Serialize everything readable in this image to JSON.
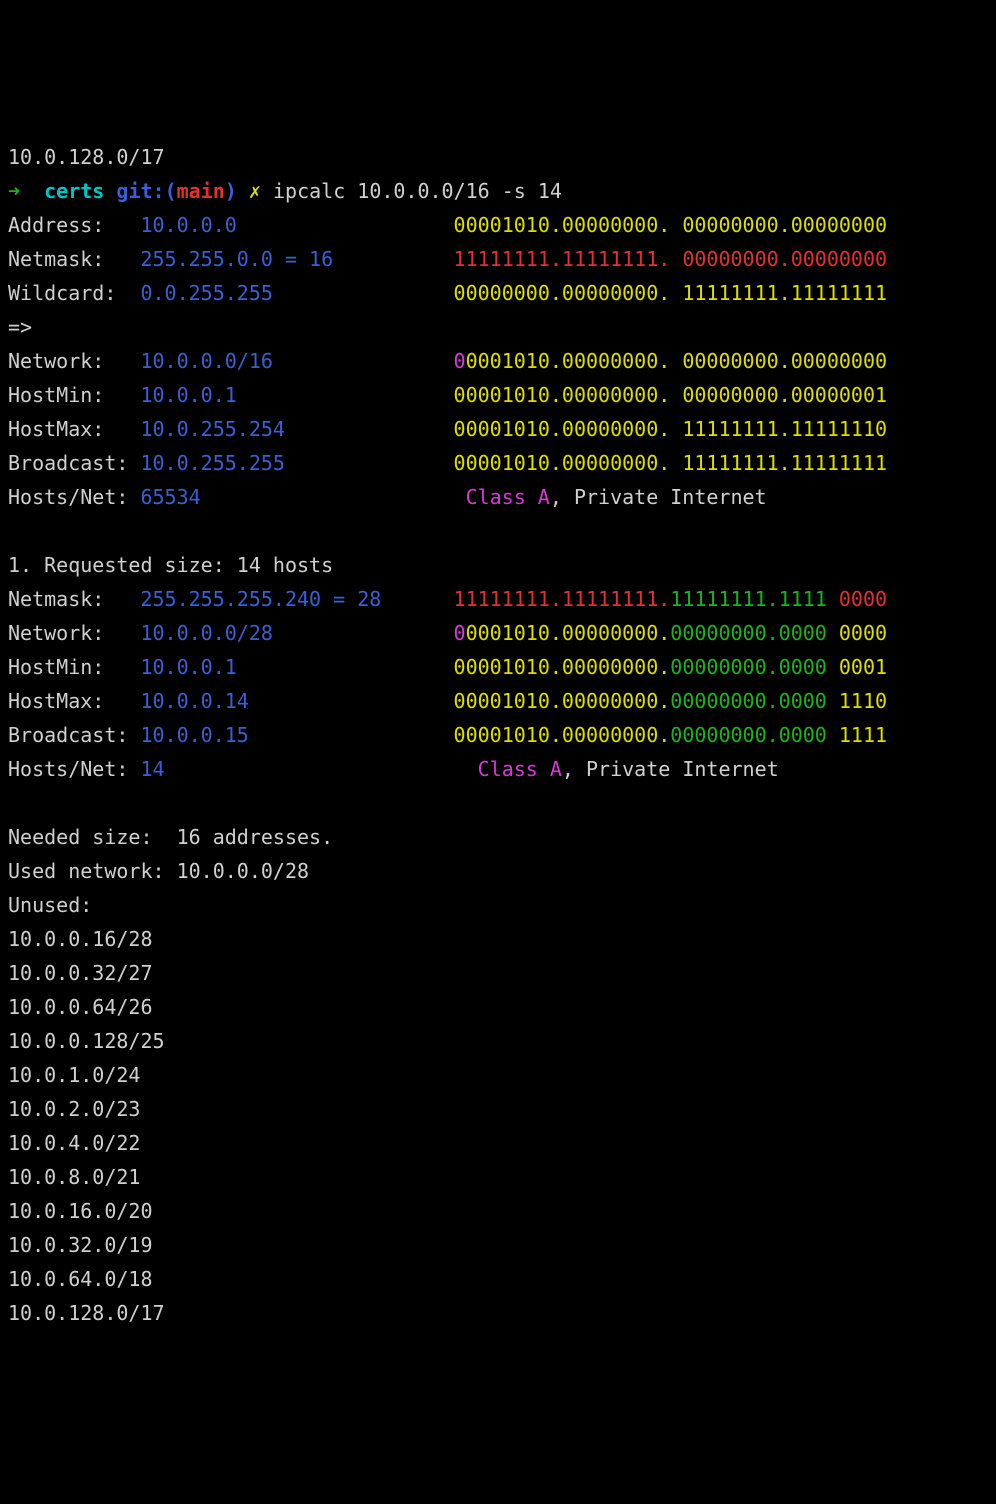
{
  "header_line": "10.0.128.0/17",
  "prompt": {
    "arrow": "➜",
    "dir": "certs",
    "git_label": "git:(",
    "branch": "main",
    "git_close": ")",
    "dirty": "✗",
    "command": "ipcalc 10.0.0.0/16 -s 14"
  },
  "block1": {
    "rows": [
      {
        "label": "Address:",
        "value": "10.0.0.0",
        "bits": [
          [
            "y",
            "00001010"
          ],
          [
            "y",
            "."
          ],
          [
            "y",
            "00000000"
          ],
          [
            "y",
            ". "
          ],
          [
            "y",
            "00000000"
          ],
          [
            "y",
            "."
          ],
          [
            "y",
            "00000000"
          ]
        ]
      },
      {
        "label": "Netmask:",
        "value": "255.255.0.0 = 16",
        "bits": [
          [
            "r",
            "11111111"
          ],
          [
            "r",
            "."
          ],
          [
            "r",
            "11111111"
          ],
          [
            "r",
            ". "
          ],
          [
            "r",
            "00000000"
          ],
          [
            "r",
            "."
          ],
          [
            "r",
            "00000000"
          ]
        ]
      },
      {
        "label": "Wildcard:",
        "value": "0.0.255.255",
        "bits": [
          [
            "y",
            "00000000"
          ],
          [
            "y",
            "."
          ],
          [
            "y",
            "00000000"
          ],
          [
            "y",
            ". "
          ],
          [
            "y",
            "11111111"
          ],
          [
            "y",
            "."
          ],
          [
            "y",
            "11111111"
          ]
        ]
      }
    ],
    "sep": "=>",
    "rows2": [
      {
        "label": "Network:",
        "value": "10.0.0.0/16",
        "bits": [
          [
            "p",
            "0"
          ],
          [
            "y",
            "0001010"
          ],
          [
            "y",
            "."
          ],
          [
            "y",
            "00000000"
          ],
          [
            "y",
            ". "
          ],
          [
            "y",
            "00000000"
          ],
          [
            "y",
            "."
          ],
          [
            "y",
            "00000000"
          ]
        ]
      },
      {
        "label": "HostMin:",
        "value": "10.0.0.1",
        "bits": [
          [
            "y",
            "00001010"
          ],
          [
            "y",
            "."
          ],
          [
            "y",
            "00000000"
          ],
          [
            "y",
            ". "
          ],
          [
            "y",
            "00000000"
          ],
          [
            "y",
            "."
          ],
          [
            "y",
            "00000001"
          ]
        ]
      },
      {
        "label": "HostMax:",
        "value": "10.0.255.254",
        "bits": [
          [
            "y",
            "00001010"
          ],
          [
            "y",
            "."
          ],
          [
            "y",
            "00000000"
          ],
          [
            "y",
            ". "
          ],
          [
            "y",
            "11111111"
          ],
          [
            "y",
            "."
          ],
          [
            "y",
            "11111110"
          ]
        ]
      },
      {
        "label": "Broadcast:",
        "value": "10.0.255.255",
        "bits": [
          [
            "y",
            "00001010"
          ],
          [
            "y",
            "."
          ],
          [
            "y",
            "00000000"
          ],
          [
            "y",
            ". "
          ],
          [
            "y",
            "11111111"
          ],
          [
            "y",
            "."
          ],
          [
            "y",
            "11111111"
          ]
        ]
      }
    ],
    "hosts": {
      "label": "Hosts/Net:",
      "value": "65534",
      "class_text": "Class A",
      "extra": ", Private Internet"
    }
  },
  "subnet_header": "1. Requested size: 14 hosts",
  "block2": {
    "rows": [
      {
        "label": "Netmask:",
        "value": "255.255.255.240 = 28",
        "bits": [
          [
            "r",
            "11111111"
          ],
          [
            "r",
            "."
          ],
          [
            "r",
            "11111111"
          ],
          [
            "r",
            "."
          ],
          [
            "g",
            "11111111"
          ],
          [
            "g",
            "."
          ],
          [
            "g",
            "1111 "
          ],
          [
            "r",
            "0000"
          ]
        ]
      },
      {
        "label": "Network:",
        "value": "10.0.0.0/28",
        "bits": [
          [
            "p",
            "0"
          ],
          [
            "y",
            "0001010"
          ],
          [
            "y",
            "."
          ],
          [
            "y",
            "00000000"
          ],
          [
            "y",
            "."
          ],
          [
            "g",
            "00000000"
          ],
          [
            "g",
            "."
          ],
          [
            "g",
            "0000 "
          ],
          [
            "y",
            "0000"
          ]
        ]
      },
      {
        "label": "HostMin:",
        "value": "10.0.0.1",
        "bits": [
          [
            "y",
            "00001010"
          ],
          [
            "y",
            "."
          ],
          [
            "y",
            "00000000"
          ],
          [
            "y",
            "."
          ],
          [
            "g",
            "00000000"
          ],
          [
            "g",
            "."
          ],
          [
            "g",
            "0000 "
          ],
          [
            "y",
            "0001"
          ]
        ]
      },
      {
        "label": "HostMax:",
        "value": "10.0.0.14",
        "bits": [
          [
            "y",
            "00001010"
          ],
          [
            "y",
            "."
          ],
          [
            "y",
            "00000000"
          ],
          [
            "y",
            "."
          ],
          [
            "g",
            "00000000"
          ],
          [
            "g",
            "."
          ],
          [
            "g",
            "0000 "
          ],
          [
            "y",
            "1110"
          ]
        ]
      },
      {
        "label": "Broadcast:",
        "value": "10.0.0.15",
        "bits": [
          [
            "y",
            "00001010"
          ],
          [
            "y",
            "."
          ],
          [
            "y",
            "00000000"
          ],
          [
            "y",
            "."
          ],
          [
            "g",
            "00000000"
          ],
          [
            "g",
            "."
          ],
          [
            "g",
            "0000 "
          ],
          [
            "y",
            "1111"
          ]
        ]
      }
    ],
    "hosts": {
      "label": "Hosts/Net:",
      "value": "14",
      "class_text": "Class A",
      "extra": ", Private Internet"
    }
  },
  "summary": {
    "needed": "Needed size:  16 addresses.",
    "used": "Used network: 10.0.0.0/28",
    "unused_label": "Unused:",
    "unused": [
      "10.0.0.16/28",
      "10.0.0.32/27",
      "10.0.0.64/26",
      "10.0.0.128/25",
      "10.0.1.0/24",
      "10.0.2.0/23",
      "10.0.4.0/22",
      "10.0.8.0/21",
      "10.0.16.0/20",
      "10.0.32.0/19",
      "10.0.64.0/18",
      "10.0.128.0/17"
    ]
  }
}
